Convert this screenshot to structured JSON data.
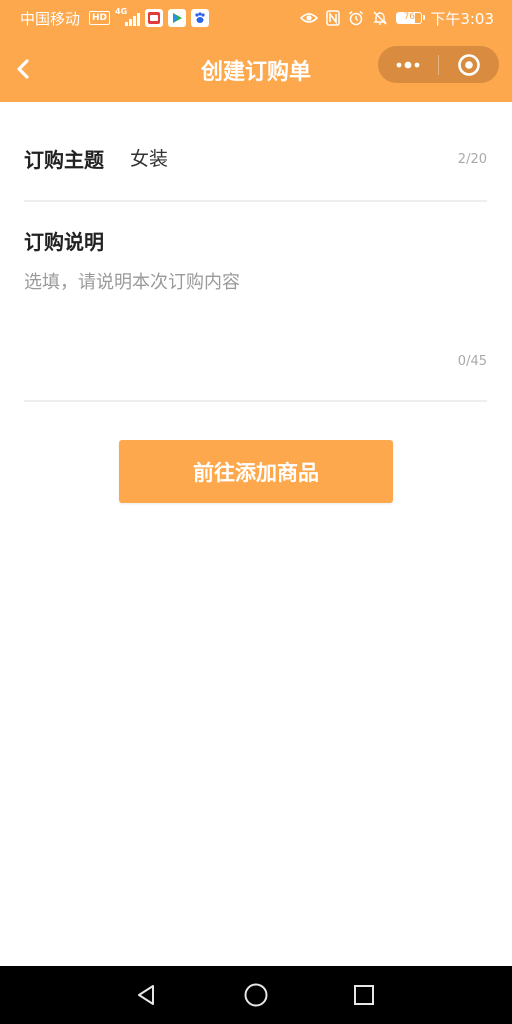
{
  "status_bar": {
    "carrier": "中国移动",
    "hd_badge": "HD",
    "network_type": "4G",
    "signal_icon": "signal-icon",
    "left_app_icons": [
      "video-app-icon",
      "media-player-icon",
      "paw-app-icon"
    ],
    "right_icons": [
      "eye-icon",
      "nfc-icon",
      "alarm-icon",
      "mute-icon"
    ],
    "battery_level": "76",
    "time": "下午3:03"
  },
  "nav": {
    "title": "创建订购单",
    "back_icon": "chevron-left-icon",
    "more_icon": "more-dots-icon",
    "close_icon": "target-circle-icon"
  },
  "form": {
    "subject": {
      "label": "订购主题",
      "value": "女装",
      "counter": "2/20"
    },
    "description": {
      "label": "订购说明",
      "placeholder": "选填，请说明本次订购内容",
      "value": "",
      "counter": "0/45"
    },
    "submit_label": "前往添加商品"
  },
  "system_nav": {
    "back_icon": "triangle-back-icon",
    "home_icon": "circle-home-icon",
    "recents_icon": "square-recents-icon"
  },
  "colors": {
    "accent": "#fda84c",
    "header_text": "#ffffff",
    "label_text": "#222222",
    "muted_text": "#aaaaaa",
    "divider": "#eeeeee",
    "system_bar": "#000000"
  }
}
